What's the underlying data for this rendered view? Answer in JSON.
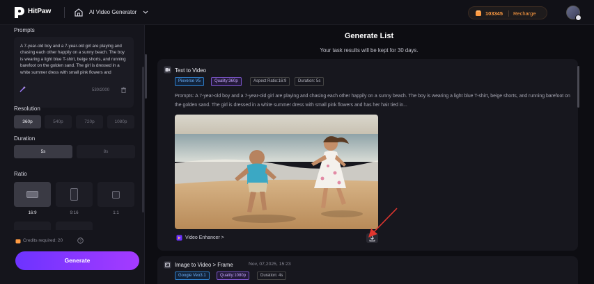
{
  "topbar": {
    "brand": "HitPaw",
    "app_title": "AI Video Generator",
    "credits": "103345",
    "recharge": "Recharge",
    "accent": "#ff9b42"
  },
  "left": {
    "prompts_label": "Prompts",
    "prompt_text": "A 7-year-old boy and a 7-year-old girl are playing and chasing each other happily on a sunny beach. The boy is wearing a light blue T-shirt, beige shorts, and running barefoot on the golden sand. The girl is dressed in a white summer dress with small pink flowers and",
    "char_count": "530/2000",
    "resolution_label": "Resolution",
    "resolutions": [
      {
        "label": "360p",
        "active": true
      },
      {
        "label": "540p",
        "active": false
      },
      {
        "label": "720p",
        "active": false
      },
      {
        "label": "1080p",
        "active": false
      }
    ],
    "duration_label": "Duration",
    "durations": [
      {
        "label": "5s",
        "active": true
      },
      {
        "label": "8s",
        "active": false
      }
    ],
    "ratio_label": "Ratio",
    "ratios": [
      {
        "label": "16:9",
        "active": true
      },
      {
        "label": "9:16",
        "active": false
      },
      {
        "label": "1:1",
        "active": false
      }
    ],
    "credits_required": "Credits required: 20",
    "generate": "Generate",
    "generate_colors": [
      "#6d33ff",
      "#a53bff"
    ]
  },
  "main": {
    "title": "Generate List",
    "subtitle": "Your task results will be kept for 30 days.",
    "card1": {
      "type": "Text to Video",
      "tags": [
        "Pixverse V5",
        "Quality:360p",
        "Aspect Ratio:16:9",
        "Duration: 5s"
      ],
      "prompt": "Prompts: A 7-year-old boy and a 7-year-old girl are playing and chasing each other happily on a sunny beach. The boy is wearing a light blue T-shirt, beige shorts, and running barefoot on the golden sand. The girl is dressed in a white summer dress with small pink flowers and has her hair tied in...",
      "enhancer": "Video Enhancer >"
    },
    "card2": {
      "type": "Image to Video > Frame",
      "date": "Nov, 07,2025, 15:23",
      "tags": [
        "Google Veo3.1",
        "Quality:1080p",
        "Duration: 4s"
      ]
    }
  }
}
